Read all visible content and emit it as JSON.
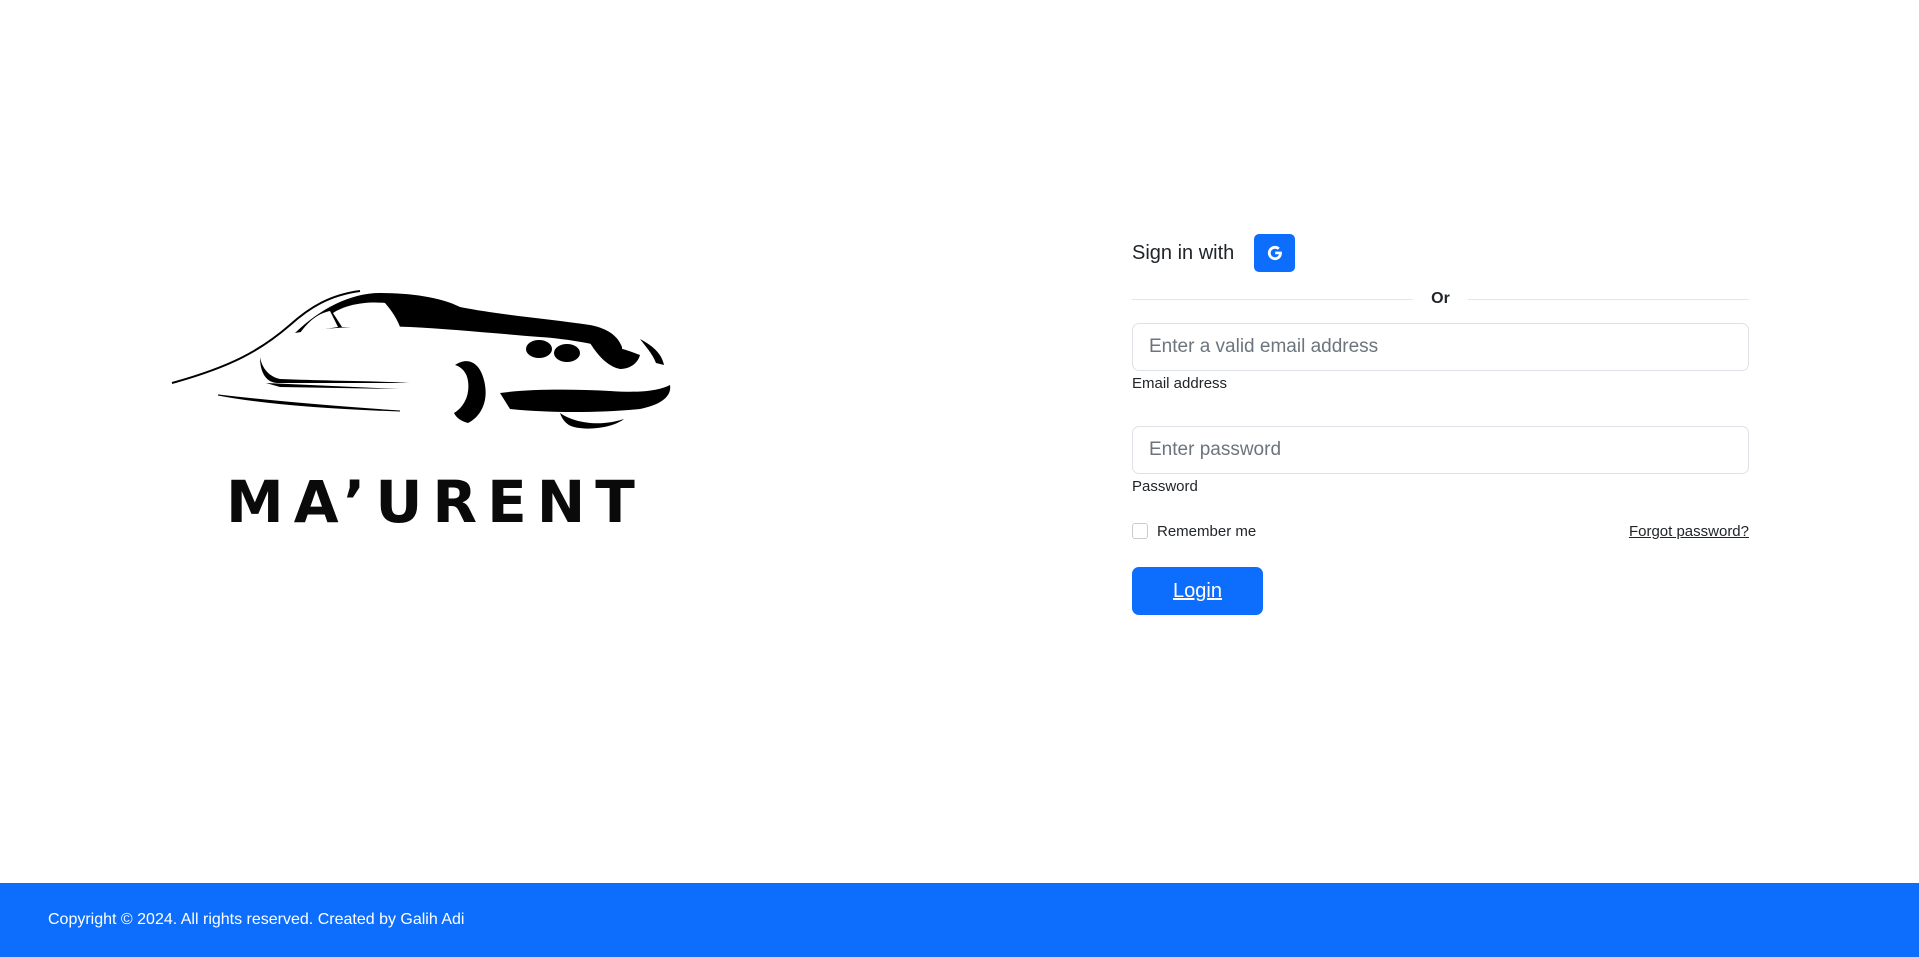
{
  "brand": {
    "name": "MA’URENT"
  },
  "signin": {
    "label": "Sign in with",
    "google_icon": "google-g-icon",
    "divider_text": "Or"
  },
  "email": {
    "placeholder": "Enter a valid email address",
    "value": "",
    "label": "Email address"
  },
  "password": {
    "placeholder": "Enter password",
    "value": "",
    "label": "Password"
  },
  "remember": {
    "label": "Remember me",
    "checked": false
  },
  "forgot": {
    "label": "Forgot password?"
  },
  "login": {
    "label": "Login"
  },
  "footer": {
    "text": "Copyright © 2024. All rights reserved. Created by Galih Adi"
  },
  "colors": {
    "accent": "#0d6efd",
    "text": "#212529",
    "border": "#dee2e6"
  }
}
